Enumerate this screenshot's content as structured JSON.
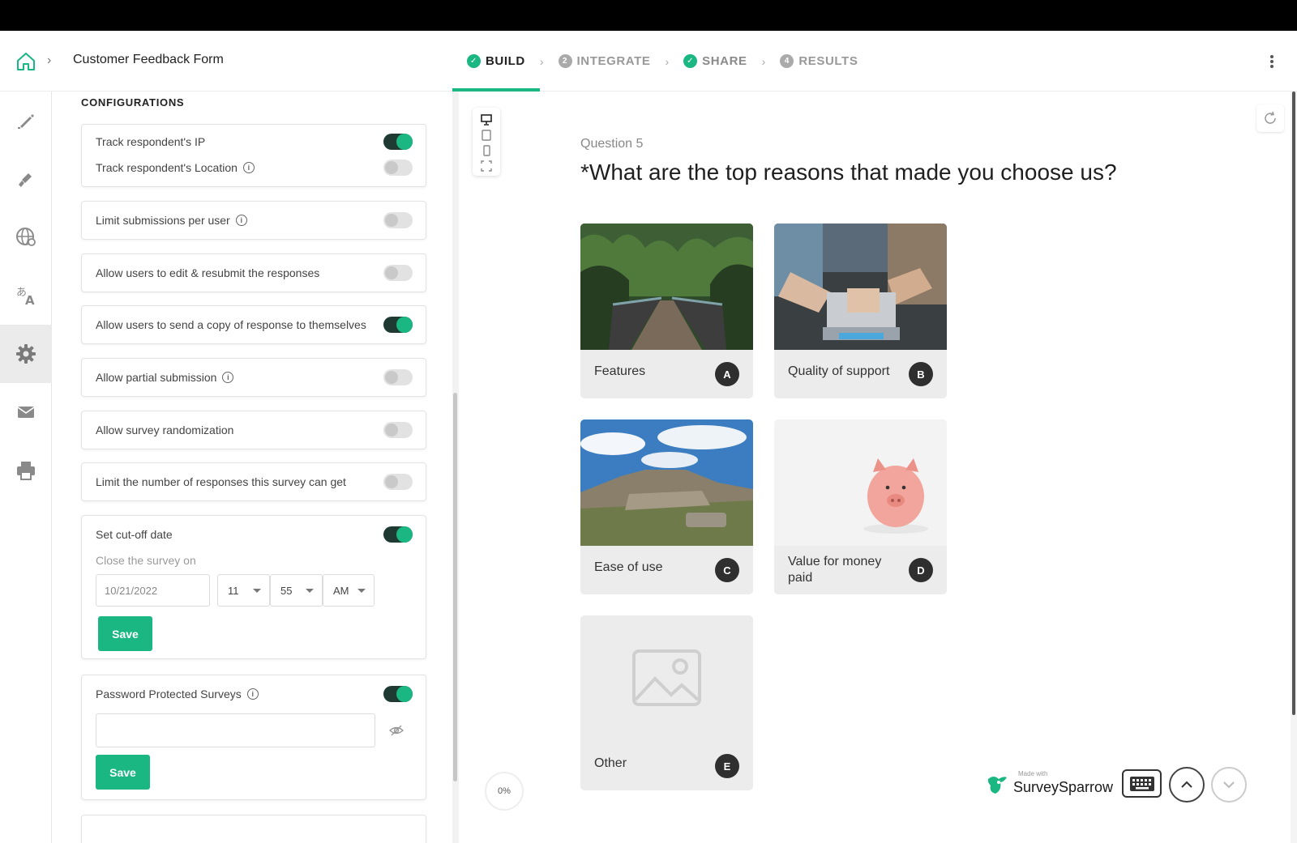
{
  "header": {
    "form_title": "Customer Feedback Form",
    "steps": [
      {
        "label": "BUILD",
        "badge": "✓",
        "state": "done-active"
      },
      {
        "label": "INTEGRATE",
        "badge": "2",
        "state": "todo"
      },
      {
        "label": "SHARE",
        "badge": "✓",
        "state": "done"
      },
      {
        "label": "RESULTS",
        "badge": "4",
        "state": "todo"
      }
    ]
  },
  "rail": {
    "items": [
      "edit-icon",
      "theme-brush-icon",
      "globe-icon",
      "translate-icon",
      "gear-icon",
      "mail-icon",
      "print-icon"
    ],
    "active": "gear-icon"
  },
  "config": {
    "title": "CONFIGURATIONS",
    "track_ip": {
      "label": "Track respondent's IP",
      "on": true
    },
    "track_location": {
      "label": "Track respondent's Location",
      "on": false
    },
    "limit_submissions": {
      "label": "Limit submissions per user",
      "on": false
    },
    "edit_resubmit": {
      "label": "Allow users to edit & resubmit the responses",
      "on": false
    },
    "send_copy": {
      "label": "Allow users to send a copy of response to themselves",
      "on": true
    },
    "partial_submission": {
      "label": "Allow partial submission",
      "on": false
    },
    "randomization": {
      "label": "Allow survey randomization",
      "on": false
    },
    "limit_responses": {
      "label": "Limit the number of responses this survey can get",
      "on": false
    },
    "cutoff": {
      "label": "Set cut-off date",
      "on": true,
      "close_label": "Close the survey on",
      "date_placeholder": "10/21/2022",
      "hour": "11",
      "minute": "55",
      "ampm": "AM",
      "save_label": "Save"
    },
    "password": {
      "label": "Password Protected Surveys",
      "on": true,
      "value": "",
      "save_label": "Save"
    }
  },
  "preview": {
    "question_number": "Question 5",
    "question_text": "*What are the top reasons that made you choose us?",
    "choices": [
      {
        "label": "Features",
        "key": "A"
      },
      {
        "label": "Quality of support",
        "key": "B"
      },
      {
        "label": "Ease of use",
        "key": "C"
      },
      {
        "label": "Value for money paid",
        "key": "D"
      },
      {
        "label": "Other",
        "key": "E"
      }
    ],
    "progress": "0%",
    "brand_made_with": "Made with",
    "brand_name": "SurveySparrow"
  },
  "colors": {
    "accent": "#1bb783",
    "toggle_dark": "#1f3a33"
  }
}
